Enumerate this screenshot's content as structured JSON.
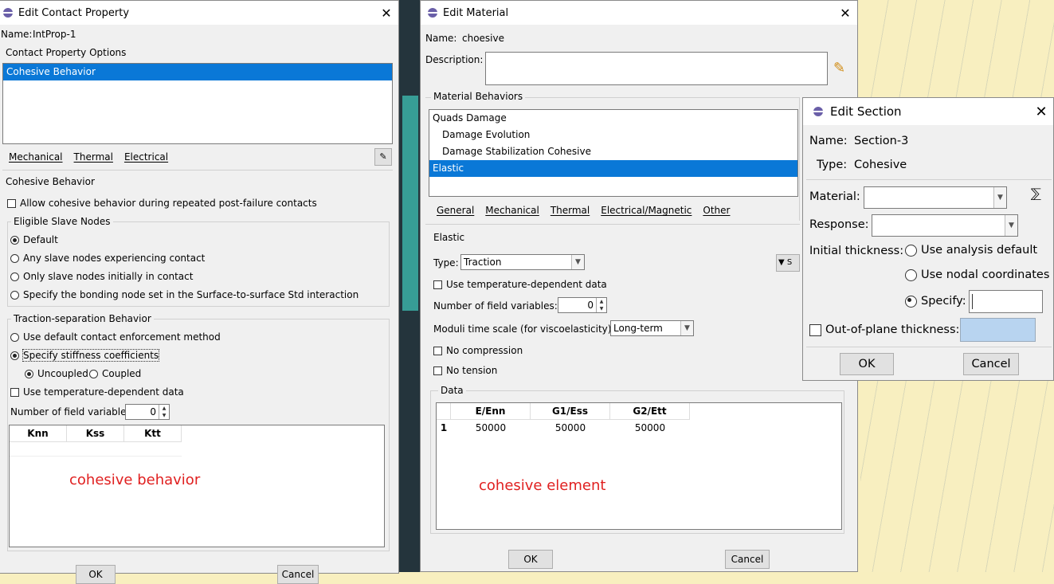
{
  "contact": {
    "title": "Edit Contact Property",
    "name_label": "Name:",
    "name_value": "IntProp-1",
    "options_group": "Contact Property Options",
    "options": [
      "Cohesive Behavior"
    ],
    "tabs": [
      "Mechanical",
      "Thermal",
      "Electrical"
    ],
    "behavior_header": "Cohesive Behavior",
    "allow_repeated": "Allow cohesive behavior during repeated post-failure contacts",
    "eligible_group": "Eligible Slave Nodes",
    "eligible_options": [
      "Default",
      "Any slave nodes experiencing contact",
      "Only slave nodes initially in contact",
      "Specify the bonding node set in the Surface-to-surface Std interaction"
    ],
    "traction_group": "Traction-separation Behavior",
    "traction_options": [
      "Use default contact enforcement method",
      "Specify stiffness coefficients"
    ],
    "coupling": [
      "Uncoupled",
      "Coupled"
    ],
    "temp_dep": "Use temperature-dependent data",
    "field_vars_label": "Number of field variables:",
    "field_vars_value": "0",
    "columns": [
      "Knn",
      "Kss",
      "Ktt"
    ],
    "annotation": "cohesive behavior",
    "ok": "OK",
    "cancel": "Cancel"
  },
  "material": {
    "title": "Edit Material",
    "name_label": "Name:",
    "name_value": "choesive",
    "description_label": "Description:",
    "behaviors_group": "Material Behaviors",
    "behaviors": [
      "Quads Damage",
      "Damage Evolution",
      "Damage Stabilization Cohesive",
      "Elastic"
    ],
    "tabs": [
      "General",
      "Mechanical",
      "Thermal",
      "Electrical/Magnetic",
      "Other"
    ],
    "elastic_header": "Elastic",
    "type_label": "Type:",
    "type_value": "Traction",
    "suboptions_fragment": "S",
    "temp_dep": "Use temperature-dependent data",
    "field_vars_label": "Number of field variables:",
    "field_vars_value": "0",
    "moduli_label": "Moduli time scale (for viscoelasticity):",
    "moduli_value": "Long-term",
    "no_compression": "No compression",
    "no_tension": "No tension",
    "data_group": "Data",
    "columns": [
      "E/Enn",
      "G1/Ess",
      "G2/Ett"
    ],
    "rows": [
      {
        "index": "1",
        "values": [
          "50000",
          "50000",
          "50000"
        ]
      }
    ],
    "annotation": "cohesive element",
    "ok": "OK",
    "cancel": "Cancel"
  },
  "section": {
    "title": "Edit Section",
    "name_label": "Name:",
    "name_value": "Section-3",
    "type_label": "Type:",
    "type_value": "Cohesive",
    "material_label": "Material:",
    "response_label": "Response:",
    "thickness_label": "Initial thickness:",
    "thickness_options": [
      "Use analysis default",
      "Use nodal coordinates",
      "Specify:"
    ],
    "out_of_plane": "Out-of-plane thickness:",
    "ok": "OK",
    "cancel": "Cancel"
  },
  "colors": {
    "selection": "#0a78d7",
    "annotation": "#e02020",
    "dialog": "#f0f0f0"
  }
}
